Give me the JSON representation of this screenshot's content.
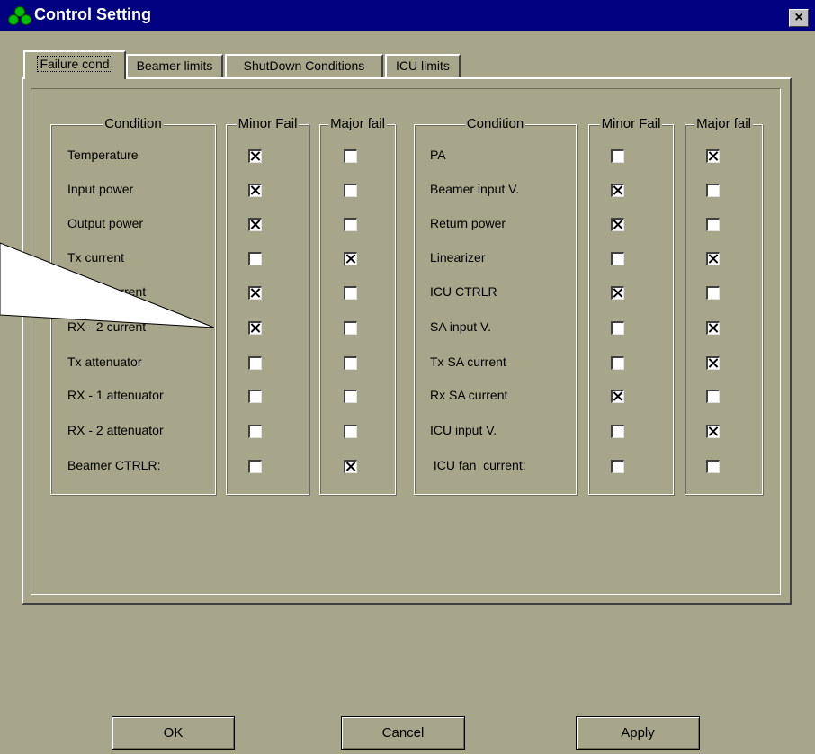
{
  "window": {
    "title": "Control Setting",
    "close_glyph": "×"
  },
  "tabs": [
    {
      "label": "Failure cond",
      "active": true
    },
    {
      "label": "Beamer limits",
      "active": false
    },
    {
      "label": "ShutDown Conditions",
      "active": false
    },
    {
      "label": "ICU limits",
      "active": false
    }
  ],
  "headers": {
    "condition_left": "Condition",
    "minor_left": "Minor Fail",
    "major_left": "Major fail",
    "condition_right": "Condition",
    "minor_right": "Minor Fail",
    "major_right": "Major fail"
  },
  "left_conditions": [
    {
      "label": "Temperature",
      "minor": true,
      "major": false
    },
    {
      "label": "Input power",
      "minor": true,
      "major": false
    },
    {
      "label": "Output power",
      "minor": true,
      "major": false
    },
    {
      "label": "Tx current",
      "minor": false,
      "major": true
    },
    {
      "label": "RX - 1 current",
      "minor": true,
      "major": false
    },
    {
      "label": "RX - 2 current",
      "minor": true,
      "major": false
    },
    {
      "label": "Tx attenuator",
      "minor": false,
      "major": false
    },
    {
      "label": "RX - 1 attenuator",
      "minor": false,
      "major": false
    },
    {
      "label": "RX - 2 attenuator",
      "minor": false,
      "major": false
    },
    {
      "label": "Beamer CTRLR:",
      "minor": false,
      "major": true
    }
  ],
  "right_conditions": [
    {
      "label": "PA",
      "minor": false,
      "major": true
    },
    {
      "label": "Beamer input V.",
      "minor": true,
      "major": false
    },
    {
      "label": "Return power",
      "minor": true,
      "major": false
    },
    {
      "label": "Linearizer",
      "minor": false,
      "major": true
    },
    {
      "label": "ICU CTRLR",
      "minor": true,
      "major": false
    },
    {
      "label": "SA input V.",
      "minor": false,
      "major": true
    },
    {
      "label": "Tx SA current",
      "minor": false,
      "major": true
    },
    {
      "label": "Rx SA current",
      "minor": true,
      "major": false
    },
    {
      "label": "ICU input V.",
      "minor": false,
      "major": true
    },
    {
      "label": " ICU fan  current:",
      "minor": false,
      "major": false
    }
  ],
  "buttons": {
    "ok": "OK",
    "cancel": "Cancel",
    "apply": "Apply"
  },
  "colors": {
    "background": "#a7a58a",
    "titlebar": "#000080",
    "icon_green": "#00c000"
  }
}
